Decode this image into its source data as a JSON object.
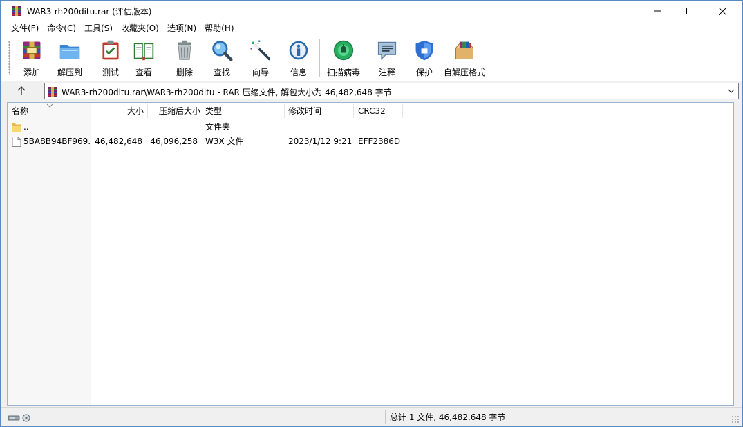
{
  "window": {
    "title": "WAR3-rh200ditu.rar (评估版本)"
  },
  "menu": [
    {
      "label": "文件(F)"
    },
    {
      "label": "命令(C)"
    },
    {
      "label": "工具(S)"
    },
    {
      "label": "收藏夹(O)"
    },
    {
      "label": "选项(N)"
    },
    {
      "label": "帮助(H)"
    }
  ],
  "toolbar": [
    {
      "label": "添加",
      "icon": "add-archive-icon"
    },
    {
      "label": "解压到",
      "icon": "extract-folder-icon"
    },
    {
      "label": "测试",
      "icon": "test-clipboard-icon"
    },
    {
      "label": "查看",
      "icon": "view-book-icon"
    },
    {
      "label": "删除",
      "icon": "delete-trash-icon"
    },
    {
      "label": "查找",
      "icon": "find-magnifier-icon"
    },
    {
      "label": "向导",
      "icon": "wizard-wand-icon"
    },
    {
      "label": "信息",
      "icon": "info-icon"
    },
    {
      "label": "扫描病毒",
      "icon": "virus-scan-icon"
    },
    {
      "label": "注释",
      "icon": "comment-icon"
    },
    {
      "label": "保护",
      "icon": "protect-shield-icon"
    },
    {
      "label": "自解压格式",
      "icon": "sfx-box-icon"
    }
  ],
  "address": {
    "path": "WAR3-rh200ditu.rar\\WAR3-rh200ditu - RAR 压缩文件, 解包大小为 46,482,648 字节"
  },
  "columns": {
    "name": "名称",
    "size": "大小",
    "packed": "压缩后大小",
    "type": "类型",
    "modified": "修改时间",
    "crc": "CRC32"
  },
  "rows": [
    {
      "name": "..",
      "size": "",
      "packed": "",
      "type": "文件夹",
      "modified": "",
      "crc": "",
      "icon": "folder-icon"
    },
    {
      "name": "5BA8B94BF969...",
      "size": "46,482,648",
      "packed": "46,096,258",
      "type": "W3X 文件",
      "modified": "2023/1/12 9:21",
      "crc": "EFF2386D",
      "icon": "file-icon"
    }
  ],
  "status": {
    "total": "总计 1 文件, 46,482,648 字节"
  },
  "colors": {
    "title_bg": "#ffffff",
    "window_border": "#5a8bbf",
    "list_border": "#9bb4d0"
  }
}
